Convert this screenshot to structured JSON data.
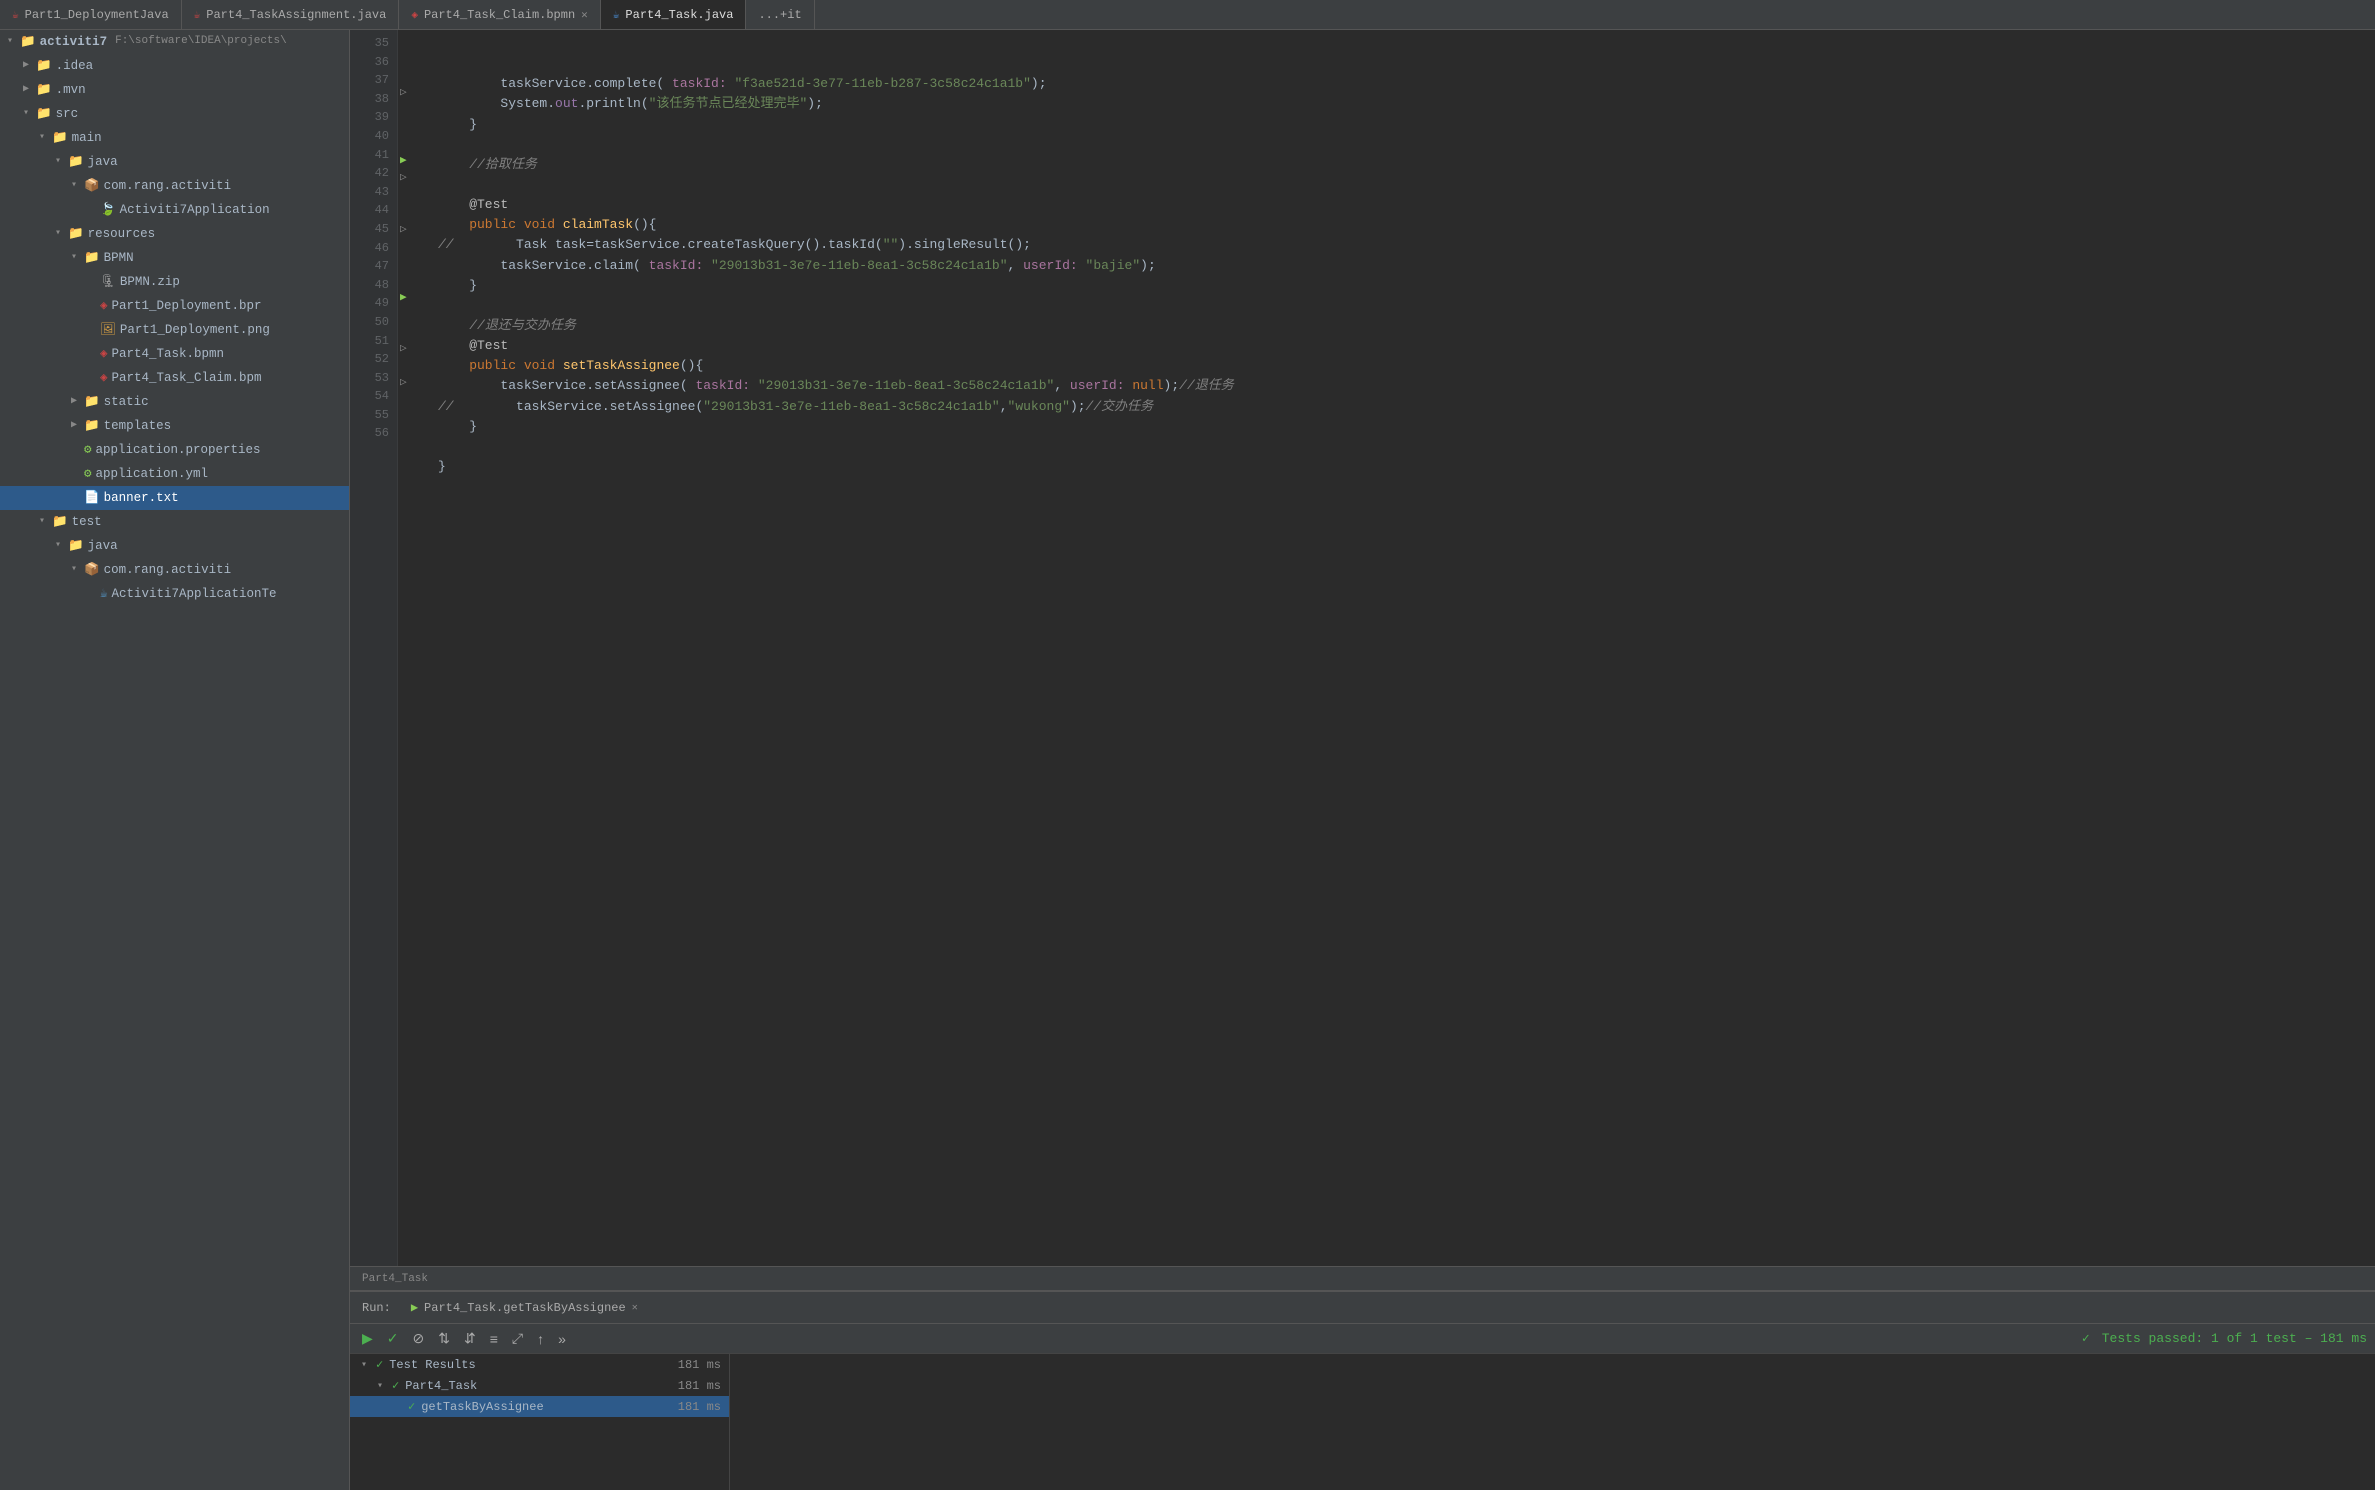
{
  "tabs": [
    {
      "label": "Part1_DeploymentJava",
      "icon": "java",
      "active": false
    },
    {
      "label": "Part4_TaskAssignment.java",
      "icon": "java",
      "active": false
    },
    {
      "label": "Part4_Task_Claim.bpmn",
      "icon": "bpmn",
      "active": false
    },
    {
      "label": "Part4_Task.java",
      "icon": "java",
      "active": true
    },
    {
      "label": "...+it",
      "icon": "java",
      "active": false
    }
  ],
  "sidebar": {
    "title": "Project",
    "tree": [
      {
        "id": "activiti7",
        "label": "activiti7",
        "type": "project",
        "indent": 4,
        "expanded": true,
        "suffix": "F:\\software\\IDEA\\projects\\"
      },
      {
        "id": "idea",
        "label": ".idea",
        "type": "folder",
        "indent": 20,
        "expanded": false
      },
      {
        "id": "mvn",
        "label": ".mvn",
        "type": "folder",
        "indent": 20,
        "expanded": false
      },
      {
        "id": "src",
        "label": "src",
        "type": "folder",
        "indent": 20,
        "expanded": true
      },
      {
        "id": "main",
        "label": "main",
        "type": "folder",
        "indent": 36,
        "expanded": true
      },
      {
        "id": "java",
        "label": "java",
        "type": "folder-blue",
        "indent": 52,
        "expanded": true
      },
      {
        "id": "com.rang.activiti",
        "label": "com.rang.activiti",
        "type": "package",
        "indent": 68,
        "expanded": true
      },
      {
        "id": "Activiti7Application",
        "label": "Activiti7Application",
        "type": "spring",
        "indent": 84
      },
      {
        "id": "resources",
        "label": "resources",
        "type": "folder",
        "indent": 52,
        "expanded": true
      },
      {
        "id": "BPMN",
        "label": "BPMN",
        "type": "folder",
        "indent": 68,
        "expanded": true
      },
      {
        "id": "BPMN.zip",
        "label": "BPMN.zip",
        "type": "zip",
        "indent": 84
      },
      {
        "id": "Part1_Deployment.bpr",
        "label": "Part1_Deployment.bpr",
        "type": "bpmn",
        "indent": 84
      },
      {
        "id": "Part1_Deployment.png",
        "label": "Part1_Deployment.png",
        "type": "png",
        "indent": 84
      },
      {
        "id": "Part4_Task.bpmn",
        "label": "Part4_Task.bpmn",
        "type": "bpmn",
        "indent": 84
      },
      {
        "id": "Part4_Task_Claim.bpm",
        "label": "Part4_Task_Claim.bpm",
        "type": "bpmn",
        "indent": 84
      },
      {
        "id": "static",
        "label": "static",
        "type": "folder",
        "indent": 68,
        "expanded": false
      },
      {
        "id": "templates",
        "label": "templates",
        "type": "folder",
        "indent": 68,
        "expanded": false
      },
      {
        "id": "application.properties",
        "label": "application.properties",
        "type": "props",
        "indent": 68
      },
      {
        "id": "application.yml",
        "label": "application.yml",
        "type": "yaml",
        "indent": 68
      },
      {
        "id": "banner.txt",
        "label": "banner.txt",
        "type": "txt",
        "indent": 68,
        "selected": true
      },
      {
        "id": "test",
        "label": "test",
        "type": "folder",
        "indent": 36,
        "expanded": true
      },
      {
        "id": "java2",
        "label": "java",
        "type": "folder-blue",
        "indent": 52,
        "expanded": true
      },
      {
        "id": "com.rang.activiti2",
        "label": "com.rang.activiti",
        "type": "package",
        "indent": 68,
        "expanded": true
      },
      {
        "id": "Activiti7ApplicationTe",
        "label": "Activiti7ApplicationTe",
        "type": "activiti",
        "indent": 84
      }
    ]
  },
  "code": {
    "lines": [
      {
        "num": 35,
        "gutter": "",
        "text": ""
      },
      {
        "num": 36,
        "gutter": "",
        "tokens": [
          {
            "t": "        taskService.complete( ",
            "c": "plain"
          },
          {
            "t": "taskId:",
            "c": "param-key"
          },
          {
            "t": " \"f3ae521d-3e77-11eb-b287-3c58c24c1a1b\"",
            "c": "str"
          },
          {
            "t": ");",
            "c": "plain"
          }
        ]
      },
      {
        "num": 37,
        "gutter": "",
        "tokens": [
          {
            "t": "        System.",
            "c": "plain"
          },
          {
            "t": "out",
            "c": "var"
          },
          {
            "t": ".println(",
            "c": "plain"
          },
          {
            "t": "\"该任务节点已经处理完毕\"",
            "c": "str"
          },
          {
            "t": ");",
            "c": "plain"
          }
        ]
      },
      {
        "num": 38,
        "gutter": "fold",
        "tokens": [
          {
            "t": "    }",
            "c": "plain"
          }
        ]
      },
      {
        "num": 39,
        "gutter": "",
        "text": ""
      },
      {
        "num": 40,
        "gutter": "",
        "tokens": [
          {
            "t": "    ",
            "c": "plain"
          },
          {
            "t": "//拾取任务",
            "c": "comment"
          }
        ]
      },
      {
        "num": 41,
        "gutter": "",
        "text": ""
      },
      {
        "num": 42,
        "gutter": "run",
        "tokens": [
          {
            "t": "    ",
            "c": "plain"
          },
          {
            "t": "@Test",
            "c": "annotation"
          }
        ]
      },
      {
        "num": 43,
        "gutter": "fold",
        "tokens": [
          {
            "t": "    ",
            "c": "plain"
          },
          {
            "t": "public ",
            "c": "kw"
          },
          {
            "t": "void ",
            "c": "kw"
          },
          {
            "t": "claimTask",
            "c": "fn"
          },
          {
            "t": "(){",
            "c": "plain"
          }
        ]
      },
      {
        "num": 44,
        "gutter": "",
        "tokens": [
          {
            "t": "//    ",
            "c": "comment"
          },
          {
            "t": "    Task task=taskService.createTaskQuery().taskId(",
            "c": "plain"
          },
          {
            "t": "\"\"",
            "c": "str"
          },
          {
            "t": ").singleResult();",
            "c": "plain"
          }
        ]
      },
      {
        "num": 45,
        "gutter": "",
        "tokens": [
          {
            "t": "        taskService.claim( ",
            "c": "plain"
          },
          {
            "t": "taskId:",
            "c": "param-key"
          },
          {
            "t": " \"29013b31-3e7e-11eb-8ea1-3c58c24c1a1b\"",
            "c": "str"
          },
          {
            "t": ", ",
            "c": "plain"
          },
          {
            "t": "userId:",
            "c": "param-key"
          },
          {
            "t": " \"bajie\"",
            "c": "str"
          },
          {
            "t": ");",
            "c": "plain"
          }
        ]
      },
      {
        "num": 46,
        "gutter": "fold",
        "tokens": [
          {
            "t": "    }",
            "c": "plain"
          }
        ]
      },
      {
        "num": 47,
        "gutter": "",
        "text": ""
      },
      {
        "num": 48,
        "gutter": "",
        "tokens": [
          {
            "t": "    ",
            "c": "plain"
          },
          {
            "t": "//退还与交办任务",
            "c": "comment"
          }
        ]
      },
      {
        "num": 49,
        "gutter": "",
        "tokens": [
          {
            "t": "    ",
            "c": "plain"
          },
          {
            "t": "@Test",
            "c": "annotation"
          }
        ]
      },
      {
        "num": 50,
        "gutter": "run",
        "tokens": [
          {
            "t": "    ",
            "c": "plain"
          },
          {
            "t": "public ",
            "c": "kw"
          },
          {
            "t": "void ",
            "c": "kw"
          },
          {
            "t": "setTaskAssignee",
            "c": "fn"
          },
          {
            "t": "(){",
            "c": "plain"
          }
        ]
      },
      {
        "num": 51,
        "gutter": "",
        "tokens": [
          {
            "t": "        taskService.setAssignee( ",
            "c": "plain"
          },
          {
            "t": "taskId:",
            "c": "param-key"
          },
          {
            "t": " \"29013b31-3e7e-11eb-8ea1-3c58c24c1a1b\"",
            "c": "str"
          },
          {
            "t": ", ",
            "c": "plain"
          },
          {
            "t": "userId:",
            "c": "param-key"
          },
          {
            "t": " null",
            "c": "kw"
          },
          {
            "t": ");//退任务",
            "c": "comment"
          }
        ]
      },
      {
        "num": 52,
        "gutter": "",
        "tokens": [
          {
            "t": "//    ",
            "c": "comment"
          },
          {
            "t": "    taskService.setAssignee(",
            "c": "plain"
          },
          {
            "t": "\"29013b31-3e7e-11eb-8ea1-3c58c24c1a1b\"",
            "c": "str"
          },
          {
            "t": ",",
            "c": "plain"
          },
          {
            "t": "\"wukong\"",
            "c": "str"
          },
          {
            "t": ");//交办任务",
            "c": "comment"
          }
        ]
      },
      {
        "num": 53,
        "gutter": "fold",
        "tokens": [
          {
            "t": "    }",
            "c": "plain"
          }
        ]
      },
      {
        "num": 54,
        "gutter": "",
        "text": ""
      },
      {
        "num": 55,
        "gutter": "fold",
        "tokens": [
          {
            "t": "}",
            "c": "plain"
          }
        ]
      },
      {
        "num": 56,
        "gutter": "",
        "text": ""
      }
    ],
    "filename": "Part4_Task"
  },
  "run_panel": {
    "tab_label": "Part4_Task.getTaskByAssignee",
    "toolbar": {
      "play": "▶",
      "check": "✓",
      "stop": "⊘",
      "sort_asc": "↑",
      "sort_desc": "↓",
      "collapse": "≡",
      "expand": "⤢",
      "up": "↑",
      "next": "»"
    },
    "status": "Tests passed: 1 of 1 test – 181 ms",
    "results": [
      {
        "label": "Test Results",
        "time": "181 ms",
        "level": 0,
        "pass": true
      },
      {
        "label": "Part4_Task",
        "time": "181 ms",
        "level": 1,
        "pass": true
      },
      {
        "label": "getTaskByAssignee",
        "time": "181 ms",
        "level": 2,
        "pass": true,
        "selected": true
      }
    ]
  }
}
